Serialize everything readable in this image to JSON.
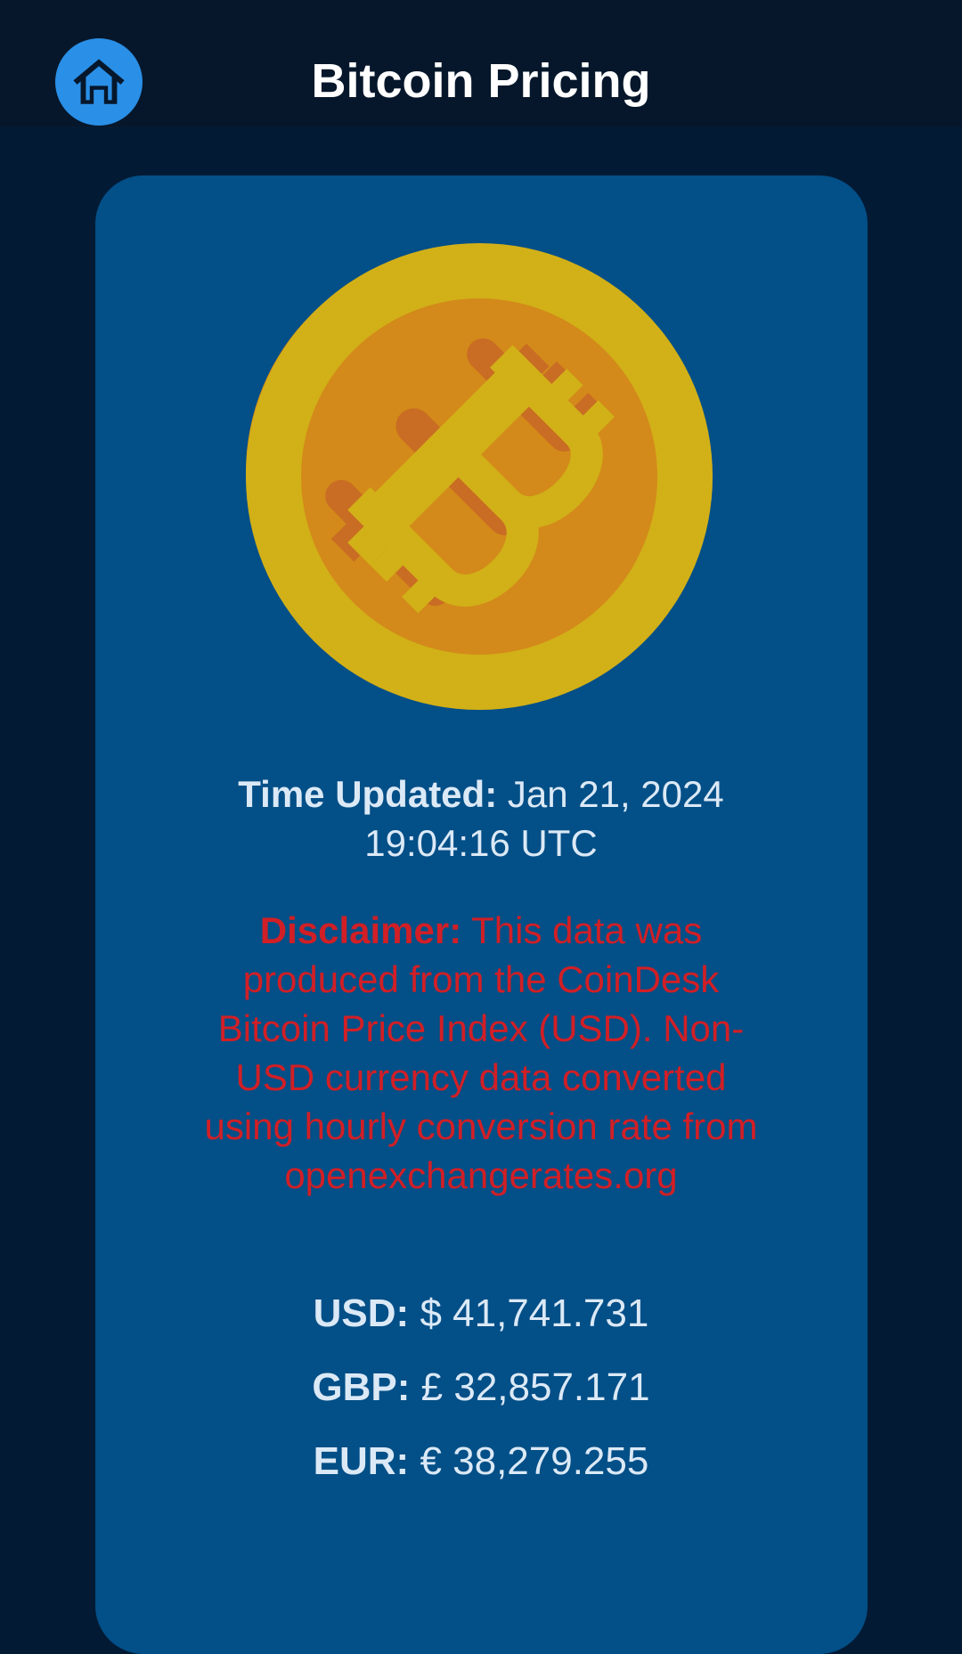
{
  "header": {
    "title": "Bitcoin Pricing",
    "home_icon": "home-icon"
  },
  "coin_icon": "bitcoin-coin-icon",
  "time": {
    "label": "Time Updated:",
    "value": "Jan 21, 2024 19:04:16 UTC"
  },
  "disclaimer": {
    "label": "Disclaimer:",
    "text": "This data was produced from the CoinDesk Bitcoin Price Index (USD). Non-USD currency data converted using hourly conversion rate from openexchangerates.org"
  },
  "prices": [
    {
      "label": "USD:",
      "value": "$ 41,741.731"
    },
    {
      "label": "GBP:",
      "value": "£ 32,857.171"
    },
    {
      "label": "EUR:",
      "value": "€ 38,279.255"
    }
  ],
  "colors": {
    "background": "#031a34",
    "app_bar": "#06172b",
    "card": "#034f87",
    "accent": "#2a8fe6",
    "disclaimer": "#d11f26",
    "coin_outer": "#d2b018",
    "coin_inner": "#d38a1a"
  }
}
